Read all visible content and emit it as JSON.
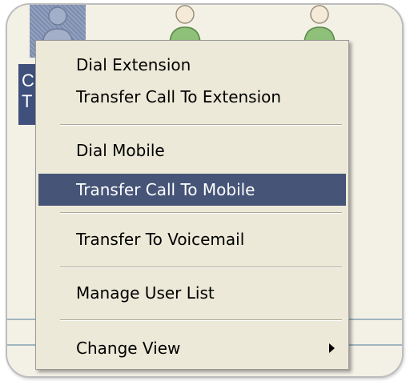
{
  "selected_user": {
    "name_initials": "C",
    "name_second_line": "T"
  },
  "context_menu": {
    "items": [
      {
        "label": "Dial Extension"
      },
      {
        "label": "Transfer Call To Extension"
      },
      {
        "label": "Dial Mobile"
      },
      {
        "label": "Transfer Call To Mobile",
        "highlighted": true
      },
      {
        "label": "Transfer To Voicemail"
      },
      {
        "label": "Manage User List"
      },
      {
        "label": "Change View",
        "has_submenu": true
      }
    ]
  },
  "colors": {
    "highlight": "#465477",
    "menu_background": "#ece9d8",
    "user_icon_green": "#8ec07a"
  },
  "icons": [
    "user-icon",
    "submenu-arrow-icon"
  ]
}
